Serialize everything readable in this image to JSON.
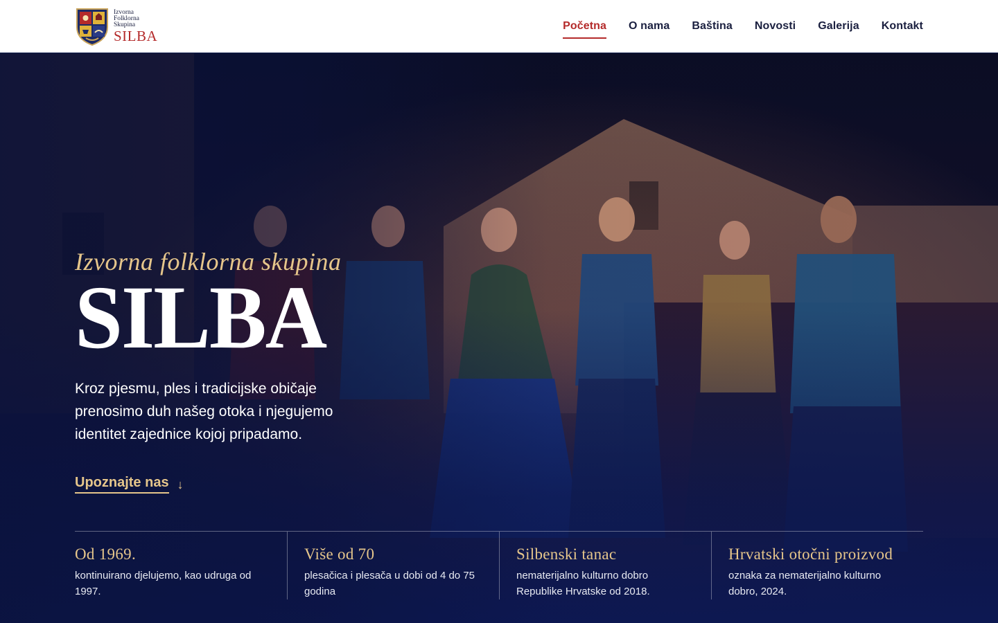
{
  "brand": {
    "small_lines": [
      "Izvorna",
      "Folklorna",
      "Skupina"
    ],
    "name": "SILBA"
  },
  "nav": {
    "items": [
      {
        "label": "Početna",
        "active": true
      },
      {
        "label": "O nama",
        "active": false
      },
      {
        "label": "Baština",
        "active": false
      },
      {
        "label": "Novosti",
        "active": false
      },
      {
        "label": "Galerija",
        "active": false
      },
      {
        "label": "Kontakt",
        "active": false
      }
    ]
  },
  "hero": {
    "kicker": "Izvorna folklorna skupina",
    "title": "SILBA",
    "description": "Kroz pjesmu, ples i tradicijske običaje prenosimo duh našeg otoka i njegujemo identitet zajednice kojoj pripadamo.",
    "cta_label": "Upoznajte nas",
    "cta_icon": "arrow-down-icon"
  },
  "stats": [
    {
      "title": "Od 1969.",
      "description": "kontinuirano djelujemo, kao udruga od 1997."
    },
    {
      "title": "Više od 70",
      "description": "plesačica i plesača u dobi od 4 do 75 godina"
    },
    {
      "title": "Silbenski tanac",
      "description": "nematerijalno kulturno dobro Republike Hrvatske od 2018."
    },
    {
      "title": "Hrvatski otočni proizvod",
      "description": "oznaka za nematerijalno kulturno dobro, 2024."
    }
  ],
  "colors": {
    "accent": "#b42a2a",
    "gold": "#e6c68b",
    "navy": "#0d1b4a",
    "nav_text": "#1a1f3f"
  }
}
